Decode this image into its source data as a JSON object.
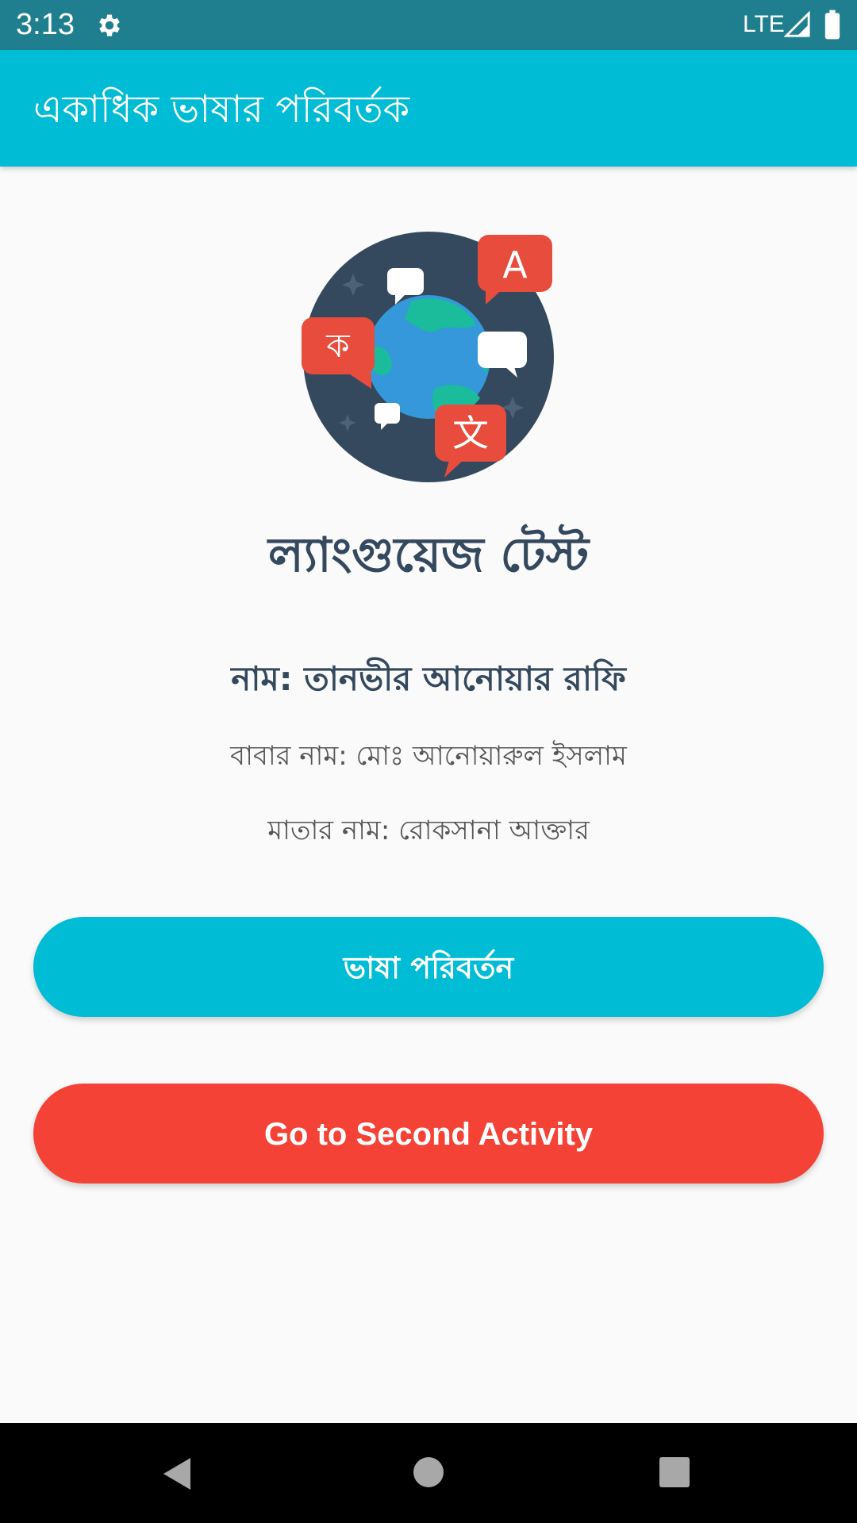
{
  "status_bar": {
    "time": "3:13",
    "network": "LTE",
    "icons": [
      "settings-icon",
      "signal-icon",
      "battery-icon"
    ]
  },
  "app_bar": {
    "title": "একাধিক ভাষার পরিবর্তক"
  },
  "logo": {
    "icon": "language-globe-icon",
    "glyphs": [
      "A",
      "ক",
      "文"
    ]
  },
  "content": {
    "heading": "ল্যাংগুয়েজ টেস্ট",
    "name": "নাম: তানভীর আনোয়ার রাফি",
    "father_name": "বাবার নাম: মোঃ আনোয়ারুল ইসলাম",
    "mother_name": "মাতার নাম: রোকসানা আক্তার"
  },
  "buttons": {
    "change_language": "ভাষা পরিবর্তন",
    "second_activity": "Go to Second Activity"
  },
  "navigation": {
    "icons": [
      "back-icon",
      "home-icon",
      "recents-icon"
    ]
  },
  "colors": {
    "status_bar": "#1f7f8e",
    "primary": "#00bcd4",
    "accent_red": "#f44336",
    "heading_text": "#34495e",
    "background": "#fafafa"
  }
}
